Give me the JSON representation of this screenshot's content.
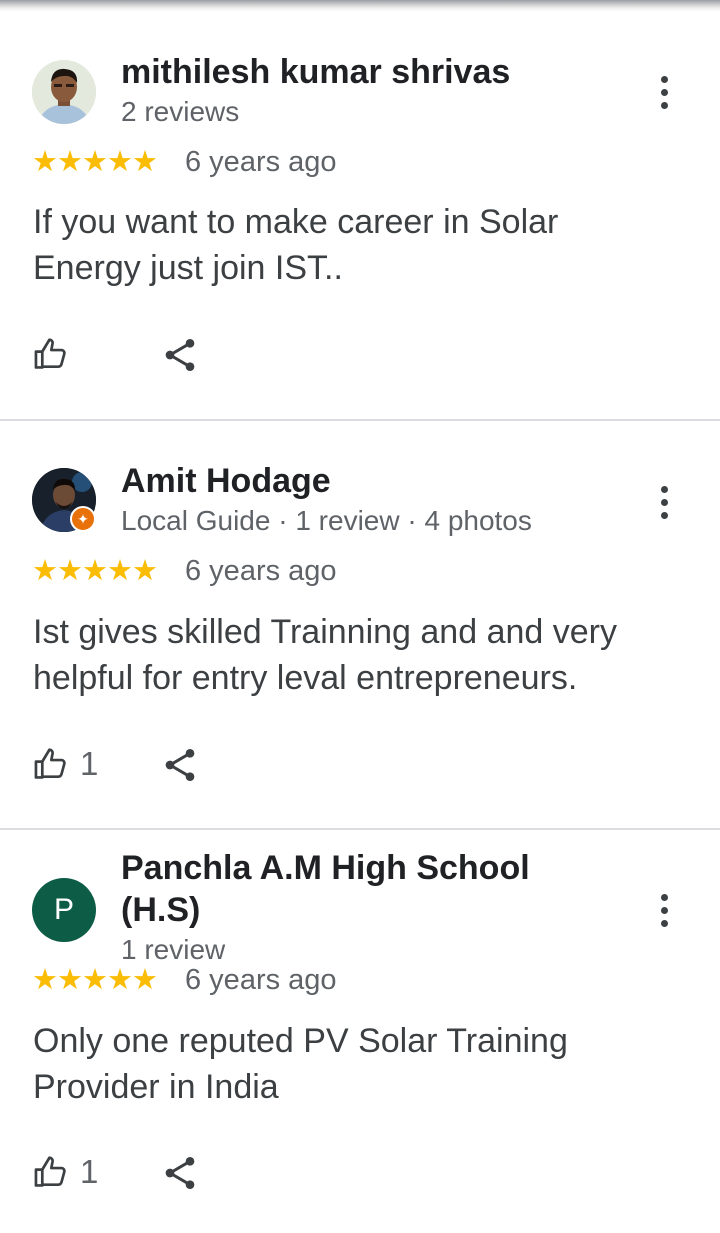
{
  "reviews": [
    {
      "author": "mithilesh kumar shrivas",
      "meta": "2 reviews",
      "stars": "★★★★★",
      "date": "6 years ago",
      "text": "If you want to make career in Solar Energy just join IST..",
      "likes": ""
    },
    {
      "author": "Amit Hodage",
      "meta": "Local Guide · 1 review · 4 photos",
      "stars": "★★★★★",
      "date": "6 years ago",
      "text": "Ist gives skilled Trainning and and very helpful for entry leval entrepreneurs.",
      "likes": "1"
    },
    {
      "author_line1": "Panchla A.M High School",
      "author_line2": "(H.S)",
      "avatar_letter": "P",
      "meta": "1 review",
      "stars": "★★★★★",
      "date": "6 years ago",
      "text": "Only one reputed PV Solar Training Provider in India",
      "likes": "1"
    }
  ],
  "colors": {
    "star": "#fbbc04",
    "avatar_p": "#0d5c45",
    "local_guide_badge": "#e8710a"
  },
  "icons": [
    "more-vert-icon",
    "thumb-up-icon",
    "share-icon",
    "local-guide-badge-icon",
    "star-icon"
  ]
}
